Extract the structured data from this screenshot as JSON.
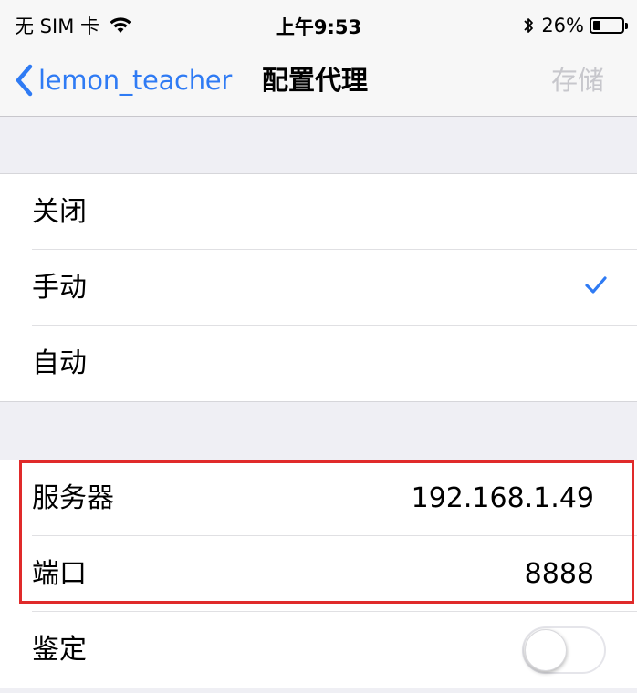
{
  "status_bar": {
    "carrier": "无 SIM 卡",
    "time": "上午9:53",
    "battery": "26%",
    "battery_level": 0.26,
    "icons": [
      "wifi-icon",
      "bluetooth-icon",
      "battery-icon"
    ]
  },
  "nav": {
    "back_label": "lemon_teacher",
    "title": "配置代理",
    "save_label": "存储"
  },
  "proxy_modes": {
    "items": [
      {
        "label": "关闭",
        "checked": false
      },
      {
        "label": "手动",
        "checked": true
      },
      {
        "label": "自动",
        "checked": false
      }
    ]
  },
  "proxy_settings": {
    "server_label": "服务器",
    "server_value": "192.168.1.49",
    "port_label": "端口",
    "port_value": "8888",
    "auth_label": "鉴定",
    "auth_enabled": false
  },
  "colors": {
    "accent": "#2f7bf4",
    "highlight": "#e02a2a",
    "background": "#efeff4"
  }
}
